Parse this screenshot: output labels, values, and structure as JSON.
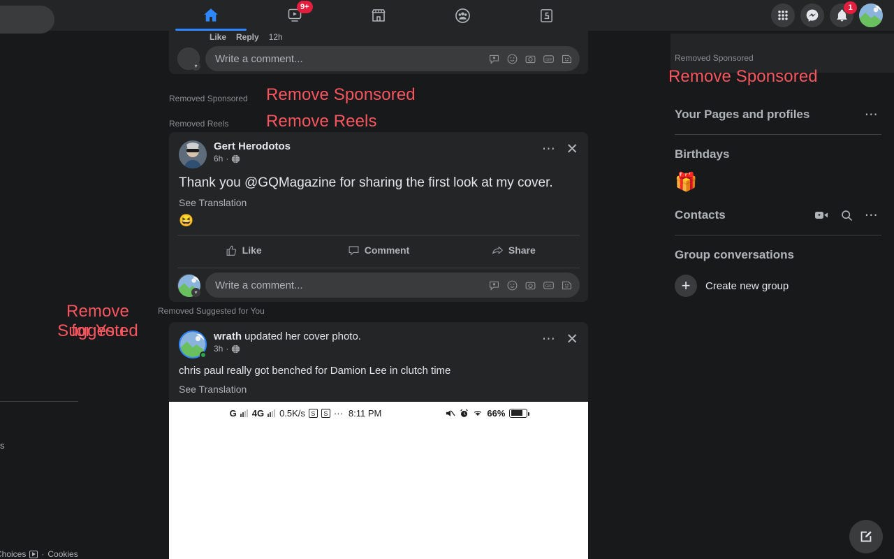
{
  "topnav": {
    "search_placeholder": "",
    "tabs": [
      {
        "name": "home",
        "icon": "home-icon",
        "active": true,
        "badge": ""
      },
      {
        "name": "video",
        "icon": "video-icon",
        "active": false,
        "badge": "9+"
      },
      {
        "name": "marketplace",
        "icon": "marketplace-icon",
        "active": false,
        "badge": ""
      },
      {
        "name": "groups",
        "icon": "groups-icon",
        "active": false,
        "badge": ""
      },
      {
        "name": "gaming",
        "icon": "gaming-icon",
        "active": false,
        "badge": ""
      }
    ],
    "right": [
      {
        "name": "menu-grid",
        "icon": "grid-icon",
        "badge": ""
      },
      {
        "name": "messenger",
        "icon": "messenger-icon",
        "badge": ""
      },
      {
        "name": "notifications",
        "icon": "bell-icon",
        "badge": "1"
      },
      {
        "name": "account",
        "icon": "avatar-icon",
        "badge": ""
      }
    ]
  },
  "top_comment": {
    "like_label": "Like",
    "reply_label": "Reply",
    "timestamp": "12h",
    "composer_placeholder": "Write a comment..."
  },
  "annotations": {
    "feed_sponsored_gray": "Removed Sponsored",
    "feed_sponsored_red": "Remove Sponsored",
    "feed_reels_gray": "Removed Reels",
    "feed_reels_red": "Remove Reels",
    "feed_suggested_gray": "Removed Suggested for You",
    "feed_suggested_red_line1": "Remove Suggested",
    "feed_suggested_red_line2": "for You",
    "rail_sponsored_gray": "Removed Sponsored",
    "rail_sponsored_red": "Remove Sponsored",
    "red_color": "#f9555f",
    "gray_color": "#8a8d91"
  },
  "post1": {
    "author": "Gert Herodotos",
    "time": "6h",
    "privacy_icon": "globe-icon",
    "text": "Thank you @GQMagazine for sharing the first look at my cover.",
    "translate_label": "See Translation",
    "reaction_emoji": "😆",
    "actions": [
      {
        "name": "like",
        "label": "Like",
        "icon": "thumbs-up-icon"
      },
      {
        "name": "comment",
        "label": "Comment",
        "icon": "comment-bubble-icon"
      },
      {
        "name": "share",
        "label": "Share",
        "icon": "share-arrow-icon"
      }
    ],
    "composer_placeholder": "Write a comment...",
    "menu_icon": "ellipsis-icon",
    "close_icon": "close-icon"
  },
  "post2": {
    "author": "wrath",
    "action_text": " updated her cover photo.",
    "time": "3h",
    "privacy_icon": "globe-icon",
    "text": "chris paul really got benched for Damion Lee in clutch time",
    "translate_label": "See Translation",
    "menu_icon": "ellipsis-icon",
    "close_icon": "close-icon",
    "screenshot_status": {
      "signal1": "G",
      "signal2": "4G",
      "speed": "0.5K/s",
      "box1": "S",
      "box2": "S",
      "dots": "···",
      "time": "8:11 PM",
      "mute_icon": "mute-icon",
      "alarm_icon": "alarm-icon",
      "wifi_icon": "wifi-icon",
      "battery_pct": "66%"
    }
  },
  "rail": {
    "pages_title": "Your Pages and profiles",
    "pages_menu_icon": "ellipsis-icon",
    "birthdays_title": "Birthdays",
    "birthday_emoji": "🎁",
    "contacts_title": "Contacts",
    "contacts_icons": [
      {
        "name": "video-room-icon"
      },
      {
        "name": "search-icon"
      },
      {
        "name": "ellipsis-icon"
      }
    ],
    "group_conversations_title": "Group conversations",
    "create_group_label": "Create new group",
    "create_group_icon": "plus-icon"
  },
  "left": {
    "fragment_text": "s",
    "footer_choices": "Choices",
    "footer_sep": "·",
    "footer_cookies": "Cookies",
    "adchoices_icon": "adchoices-icon"
  },
  "fab": {
    "name": "compose-button",
    "icon": "compose-pencil-icon"
  }
}
